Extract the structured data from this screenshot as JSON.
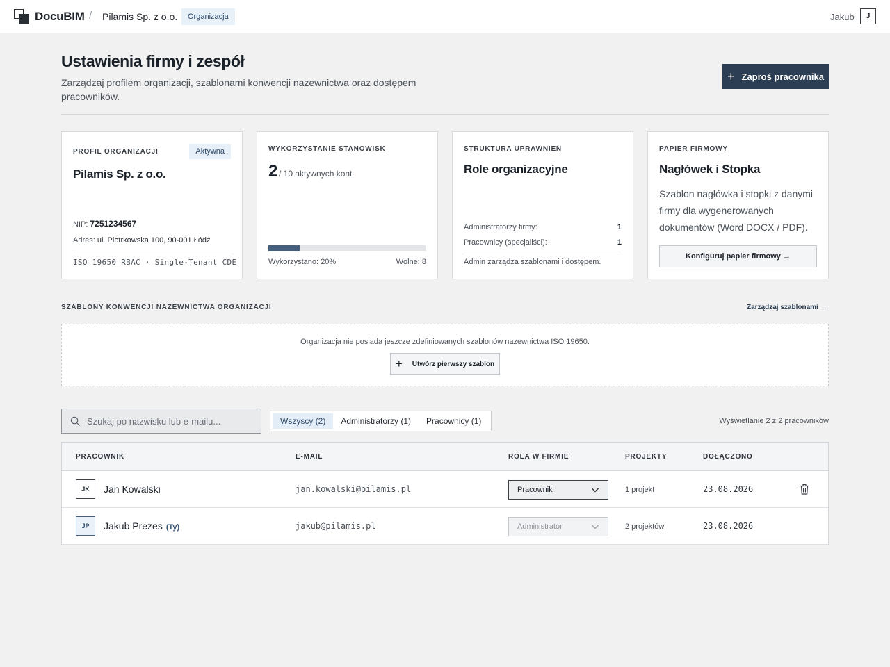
{
  "topbar": {
    "brand": "DocuBIM",
    "separator": "/",
    "org_name": "Pilamis Sp. z o.o.",
    "org_pill": "Organizacja",
    "user_name": "Jakub",
    "user_initial": "J"
  },
  "header": {
    "title": "Ustawienia firmy i zespół",
    "subtitle": "Zarządzaj profilem organizacji, szablonami konwencji nazewnictwa oraz dostępem pracowników.",
    "invite_button": "Zaproś pracownika",
    "invite_icon": "+"
  },
  "cards": {
    "profile": {
      "label": "PROFIL ORGANIZACJI",
      "badge": "Aktywna",
      "title": "Pilamis Sp. z o.o.",
      "nip_label": "NIP:",
      "nip_value": "7251234567",
      "address_label": "Adres:",
      "address_value": "ul. Piotrkowska 100, 90-001 Łódź",
      "tech": "ISO 19650 RBAC · Single-Tenant CDE"
    },
    "seats": {
      "label": "WYKORZYSTANIE STANOWISK",
      "used": "2",
      "total_text": "/ 10 aktywnych kont",
      "usage_fraction": 0.2,
      "used_text": "Wykorzystano: 20%",
      "free_text": "Wolne: 8"
    },
    "roles": {
      "label": "STRUKTURA UPRAWNIEŃ",
      "title": "Role organizacyjne",
      "admins_label": "Administratorzy firmy:",
      "admins_count": "1",
      "workers_label": "Pracownicy (specjaliści):",
      "workers_count": "1",
      "note": "Admin zarządza szablonami i dostępem."
    },
    "paper": {
      "label": "PAPIER FIRMOWY",
      "title": "Nagłówek i Stopka",
      "description": "Szablon nagłówka i stopki z danymi firmy dla wygenerowanych dokumentów (Word DOCX / PDF).",
      "button": "Konfiguruj papier firmowy →"
    }
  },
  "templates": {
    "label": "SZABLONY KONWENCJI NAZEWNICTWA ORGANIZACJI",
    "manage_link": "Zarządzaj szablonami →",
    "empty_text": "Organizacja nie posiada jeszcze zdefiniowanych szablonów nazewnictwa ISO 19650.",
    "create_button": "Utwórz pierwszy szablon",
    "create_icon": "+"
  },
  "filters": {
    "search_placeholder": "Szukaj po nazwisku lub e-mailu...",
    "tabs": [
      {
        "label": "Wszyscy (2)",
        "active": true
      },
      {
        "label": "Administratorzy (1)",
        "active": false
      },
      {
        "label": "Pracownicy (1)",
        "active": false
      }
    ],
    "count_text": "Wyświetlanie 2 z 2 pracowników"
  },
  "table": {
    "columns": [
      "PRACOWNIK",
      "E-MAIL",
      "ROLA W FIRMIE",
      "PROJEKTY",
      "DOŁĄCZONO"
    ],
    "rows": [
      {
        "initials": "JK",
        "name": "Jan Kowalski",
        "you": "",
        "email": "jan.kowalski@pilamis.pl",
        "role": "Pracownik",
        "role_editable": true,
        "projects": "1 projekt",
        "joined": "23.08.2026",
        "deletable": true
      },
      {
        "initials": "JP",
        "name": "Jakub Prezes",
        "you": "(Ty)",
        "email": "jakub@pilamis.pl",
        "role": "Administrator",
        "role_editable": false,
        "projects": "2 projektów",
        "joined": "23.08.2026",
        "deletable": false
      }
    ]
  },
  "colors": {
    "primary": "#2c3e53",
    "accent_light": "#e3edf7",
    "progress_fill": "#44607e"
  },
  "icons": {
    "logo": "docubim-logo-icon",
    "search": "search-icon",
    "chevron": "chevron-down-icon",
    "trash": "trash-icon"
  }
}
